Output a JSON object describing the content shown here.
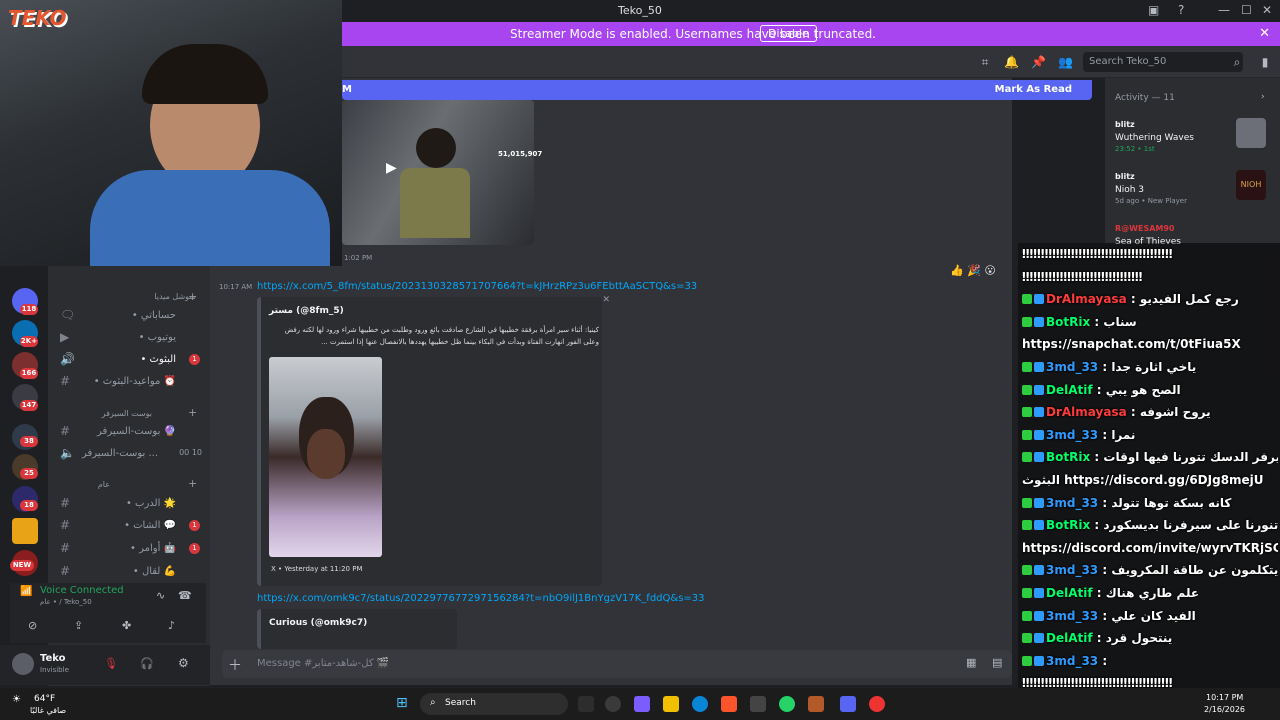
{
  "window": {
    "title": "Teko_50"
  },
  "banner": {
    "text": "Streamer Mode is enabled. Usernames have been truncated.",
    "button": "Disable"
  },
  "header": {
    "search_placeholder": "Search Teko_50"
  },
  "new_bar": {
    "left": "M",
    "right": "Mark As Read"
  },
  "servers": [
    {
      "badge": "118"
    },
    {
      "badge": "2K+"
    },
    {
      "badge": "166"
    },
    {
      "badge": "147"
    },
    {
      "badge": "38"
    },
    {
      "badge": "25"
    },
    {
      "badge": "18"
    },
    {
      "badge": ""
    },
    {
      "badge": "NEW"
    }
  ],
  "channels": [
    {
      "type": "cat",
      "name": "سوشل ميديا"
    },
    {
      "type": "ch",
      "name": "• حساباتي",
      "badge": ""
    },
    {
      "type": "ch",
      "name": "• يوتيوب",
      "badge": ""
    },
    {
      "type": "ch",
      "name": "• البثوث",
      "badge": "1",
      "active": true
    },
    {
      "type": "ch",
      "name": "• مواعيد-البثوث ⏰",
      "badge": ""
    },
    {
      "type": "cat",
      "name": "بوست السيرفر"
    },
    {
      "type": "ch",
      "name": "بوست-السيرفر 🔮",
      "badge": ""
    },
    {
      "type": "ch",
      "name": "بوست-السيرفر ...",
      "badge": "",
      "extra": "00  10"
    },
    {
      "type": "cat",
      "name": "عام"
    },
    {
      "type": "ch",
      "name": "• الدرب 🌟",
      "badge": ""
    },
    {
      "type": "ch",
      "name": "• الشات 💬",
      "badge": "1"
    },
    {
      "type": "ch",
      "name": "• أوامر 🤖",
      "badge": "1"
    },
    {
      "type": "ch",
      "name": "• لقال 💪",
      "badge": ""
    }
  ],
  "voice": {
    "status": "Voice Connected",
    "channel": "عام • / Teko_50"
  },
  "user": {
    "name": "Teko",
    "status": "Invisible"
  },
  "messages": {
    "top_time": "1:02 PM",
    "video_overlay": "51,015,907",
    "msg_time": "10:17 AM",
    "link1": "https://x.com/5_8fm/status/2023130328571707664?t=kJHrzRPz3u6FEbttAaSCTQ&s=33",
    "embed1_author": "مستر (@8fm_5)",
    "embed1_text": "كينيا: أثناء سير امرأة برفقة خطيبها في الشارع صادفت بائع ورود وطلبت من خطيبها شراء ورود لها لكنه رفض وعلى الفور انهارت الفتاة وبدأت في البكاء بينما ظل خطيبها يهددها بالانفصال عنها إذا استمرت ...",
    "embed1_footer": "X • Yesterday at 11:20 PM",
    "link2": "https://x.com/omk9c7/status/2022977677297156284?t=nbO9ilJ1BnYgzV17K_fddQ&s=33",
    "embed2_author": "Curious (@omk9c7)"
  },
  "composer": {
    "placeholder": "Message #كل-شاهد-متابر 🎬"
  },
  "activity": {
    "title": "Activity — 11",
    "items": [
      {
        "user": "blitz",
        "game": "Wuthering Waves",
        "meta": "23:52  •  1st"
      },
      {
        "user": "blitz",
        "game": "Nioh 3",
        "meta": "5d ago  •  New Player"
      },
      {
        "user": "R@WESAM90",
        "game": "Sea of Thieves",
        "meta": ""
      }
    ]
  },
  "chat": [
    {
      "user": "",
      "text": "‼‼‼‼‼‼‼‼‼‼‼‼‼‼‼‼‼‼‼‼",
      "color": "#ffffff"
    },
    {
      "user": "",
      "text": "‼‼‼‼‼‼‼‼‼‼‼‼‼‼‼‼",
      "color": "#ffffff"
    },
    {
      "user": "DrAlmayasa",
      "text": ": رجع كمل الفيديو",
      "color": "#ff3b3b"
    },
    {
      "user": "BotRix",
      "text": ": سناب",
      "color": "#00ff6a"
    },
    {
      "user": "",
      "text": "https://snapchat.com/t/0tFiua5X",
      "color": "#ffffff"
    },
    {
      "user": "3md_33",
      "text": ": ياخي اثارة جدا",
      "color": "#2e9bff"
    },
    {
      "user": "DelAtif",
      "text": ": الصح هو يبي",
      "color": "#00ff6a"
    },
    {
      "user": "DrAlmayasa",
      "text": ": يروح اشوفه",
      "color": "#ff3b3b"
    },
    {
      "user": "3md_33",
      "text": ": نمرا",
      "color": "#2e9bff"
    },
    {
      "user": "BotRix",
      "text": ": هذا سيرفر الدسك تتورنا فيها اوقات",
      "color": "#00ff6a"
    },
    {
      "user": "",
      "text": "البثوث https://discord.gg/6DJg8mejU",
      "color": "#ffffff"
    },
    {
      "user": "3md_33",
      "text": ": كانه بسكة توها تتولد",
      "color": "#2e9bff"
    },
    {
      "user": "BotRix",
      "text": ": تنورنا على سيرفرنا بديسكورد",
      "color": "#00ff6a"
    },
    {
      "user": "",
      "text": "https://discord.com/invite/wyrvTKRjSG",
      "color": "#ffffff"
    },
    {
      "user": "3md_33",
      "text": ": يتكلمون عن طاقة المكرويف",
      "color": "#2e9bff"
    },
    {
      "user": "DelAtif",
      "text": ": علم طاري هناك",
      "color": "#00ff6a"
    },
    {
      "user": "3md_33",
      "text": ": الفيد كان علي",
      "color": "#2e9bff"
    },
    {
      "user": "DelAtif",
      "text": ": ينتحول قرد",
      "color": "#00ff6a"
    },
    {
      "user": "3md_33",
      "text": ":",
      "color": "#2e9bff"
    },
    {
      "user": "",
      "text": "‼‼‼‼‼‼‼‼‼‼‼‼‼‼‼‼‼‼‼‼",
      "color": "#ffffff"
    },
    {
      "user": "",
      "text": "‼‼‼‼‼‼‼‼‼‼‼‼‼‼‼‼‼‼‼‼",
      "color": "#ffffff"
    }
  ],
  "taskbar": {
    "weather_temp": "64°F",
    "weather_desc": "صافي غالبًا",
    "search": "Search",
    "time": "10:17 PM",
    "date": "2/16/2026"
  },
  "cam_logo": "TEKO"
}
